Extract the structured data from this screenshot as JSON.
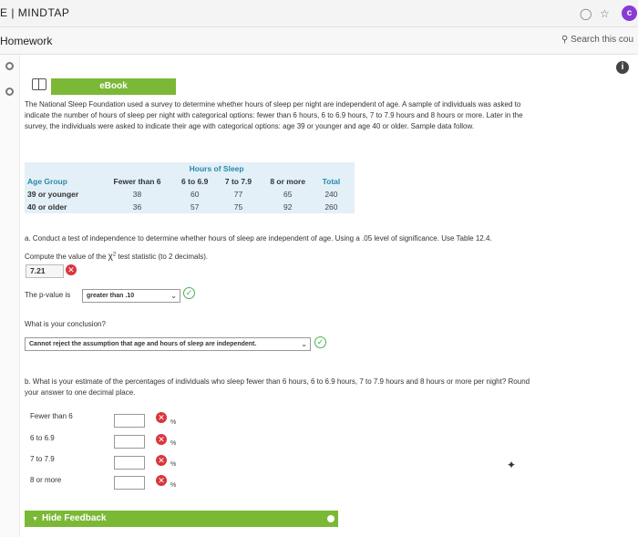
{
  "topbar": {
    "brand": "E | MINDTAP",
    "icons": [
      "bell-icon",
      "star-icon",
      "avatar"
    ],
    "avatar_initial": "c"
  },
  "section": {
    "title": "Homework",
    "search_placeholder": "Search this cou"
  },
  "ebook_label": "eBook",
  "intro": {
    "line1": "The National Sleep Foundation used a survey to determine whether hours of sleep per night are independent of age. A sample of individuals was asked to",
    "line2": "indicate the number of hours of sleep per night with categorical options: fewer than 6 hours, 6 to 6.9 hours, 7 to 7.9 hours and 8 hours or more. Later in the",
    "line3": "survey, the individuals were asked to indicate their age with categorical options: age 39 or younger and age 40 or older. Sample data follow."
  },
  "table": {
    "super_header": "Hours of Sleep",
    "headers": [
      "Age Group",
      "Fewer than 6",
      "6 to 6.9",
      "7 to 7.9",
      "8 or more",
      "Total"
    ],
    "rows": [
      {
        "label": "39 or younger",
        "values": [
          "38",
          "60",
          "77",
          "65",
          "240"
        ]
      },
      {
        "label": "40 or older",
        "values": [
          "36",
          "57",
          "75",
          "92",
          "260"
        ]
      }
    ]
  },
  "part_a": {
    "instruction": "a. Conduct a test of independence to determine whether hours of sleep are independent of age. Using a .05 level of significance. Use Table 12.4.",
    "chi_prompt_pre": "Compute the value of the",
    "chi_symbol": "χ",
    "chi_exp": "2",
    "chi_prompt_post": "test statistic (to 2 decimals).",
    "chi_value": "7.21",
    "pvalue_label": "The p-value is",
    "pvalue_selected": "greater than .10",
    "conclusion_question": "What is your conclusion?",
    "conclusion_selected": "Cannot reject the assumption that age and hours of sleep are independent."
  },
  "part_b": {
    "instruction_line1": "b. What is your estimate of the percentages of individuals who sleep fewer than 6 hours, 6 to 6.9 hours, 7 to 7.9 hours and 8 hours or more per night? Round",
    "instruction_line2": "your answer to one decimal place.",
    "rows": [
      {
        "label": "Fewer than 6",
        "value": "",
        "unit": "%"
      },
      {
        "label": "6 to 6.9",
        "value": "",
        "unit": "%"
      },
      {
        "label": "7 to 7.9",
        "value": "",
        "unit": "%"
      },
      {
        "label": "8 or more",
        "value": "",
        "unit": "%"
      }
    ]
  },
  "feedback_label": "Hide Feedback",
  "colors": {
    "accent_green": "#7bb836",
    "error_red": "#d9363e",
    "correct_green": "#4caf50",
    "table_bg": "#e3f0f8"
  }
}
